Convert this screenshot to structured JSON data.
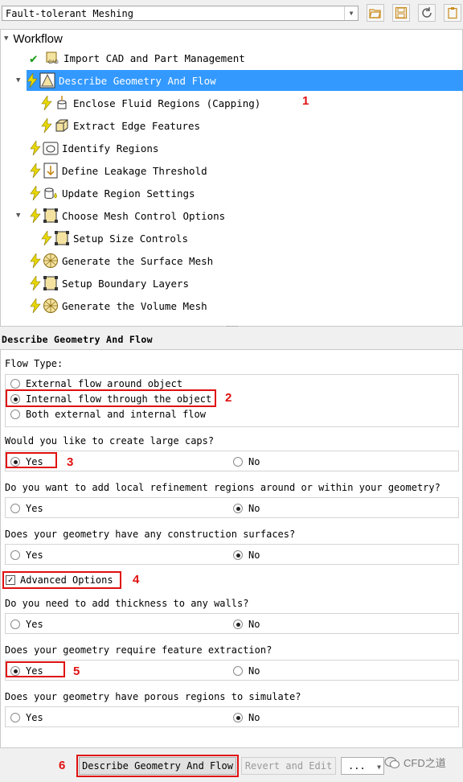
{
  "toolbar": {
    "mode_value": "Fault-tolerant Meshing",
    "buttons": [
      "open-icon",
      "save-icon",
      "refresh-icon",
      "clipboard-icon"
    ]
  },
  "workflow": {
    "title": "Workflow",
    "tasks": [
      {
        "label": "Import CAD and Part Management",
        "status": "done"
      },
      {
        "label": "Describe Geometry And Flow",
        "status": "pending",
        "selected": true
      },
      {
        "label": "Enclose Fluid Regions (Capping)",
        "status": "pending"
      },
      {
        "label": "Extract Edge Features",
        "status": "pending"
      },
      {
        "label": "Identify Regions",
        "status": "pending"
      },
      {
        "label": "Define Leakage Threshold",
        "status": "pending"
      },
      {
        "label": "Update Region Settings",
        "status": "pending"
      },
      {
        "label": "Choose Mesh Control Options",
        "status": "pending"
      },
      {
        "label": "Setup Size Controls",
        "status": "pending"
      },
      {
        "label": "Generate the Surface Mesh",
        "status": "pending"
      },
      {
        "label": "Setup Boundary Layers",
        "status": "pending"
      },
      {
        "label": "Generate the Volume Mesh",
        "status": "pending"
      }
    ]
  },
  "form": {
    "title": "Describe Geometry And Flow",
    "flow_type_label": "Flow Type:",
    "flow_options": [
      "External flow around object",
      "Internal flow through the object",
      "Both external and internal flow"
    ],
    "flow_selected": 1,
    "questions": [
      {
        "text": "Would you like to create large caps?",
        "yes": "Yes",
        "no": "No",
        "selected": "Yes"
      },
      {
        "text": "Do you want to add local refinement regions around or within your geometry?",
        "yes": "Yes",
        "no": "No",
        "selected": "No"
      },
      {
        "text": "Does your geometry have any construction surfaces?",
        "yes": "Yes",
        "no": "No",
        "selected": "No"
      },
      {
        "text": "Do you need to add thickness to any walls?",
        "yes": "Yes",
        "no": "No",
        "selected": "No"
      },
      {
        "text": "Does your geometry require feature extraction?",
        "yes": "Yes",
        "no": "No",
        "selected": "Yes"
      },
      {
        "text": "Does your geometry have porous regions to simulate?",
        "yes": "Yes",
        "no": "No",
        "selected": "No"
      }
    ],
    "advanced_label": "Advanced Options",
    "advanced_checked": true
  },
  "buttons": {
    "primary": "Describe Geometry And Flow",
    "revert": "Revert and Edit",
    "more": "..."
  },
  "annotations": [
    "1",
    "2",
    "3",
    "4",
    "5",
    "6"
  ],
  "watermark": "CFD之道",
  "colors": {
    "selection": "#3399ff",
    "annotation": "#e01010",
    "bolt": "#e8d800",
    "check": "#1a9a1a"
  }
}
